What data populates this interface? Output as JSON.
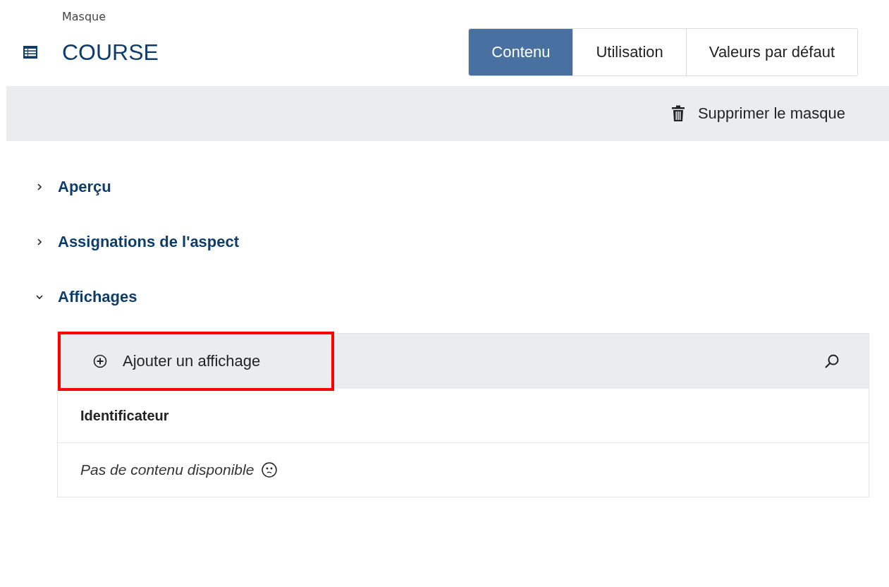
{
  "breadcrumb": "Masque",
  "title": "COURSE",
  "tabs": [
    {
      "label": "Contenu",
      "selected": true
    },
    {
      "label": "Utilisation",
      "selected": false
    },
    {
      "label": "Valeurs par défaut",
      "selected": false
    }
  ],
  "toolbar": {
    "delete_label": "Supprimer le masque"
  },
  "sections": [
    {
      "title": "Aperçu",
      "expanded": false
    },
    {
      "title": "Assignations de l'aspect",
      "expanded": false
    },
    {
      "title": "Affichages",
      "expanded": true
    }
  ],
  "displays": {
    "add_label": "Ajouter un affichage",
    "add_highlighted": true,
    "columns": [
      "Identificateur"
    ],
    "empty_message": "Pas de contenu disponible"
  }
}
